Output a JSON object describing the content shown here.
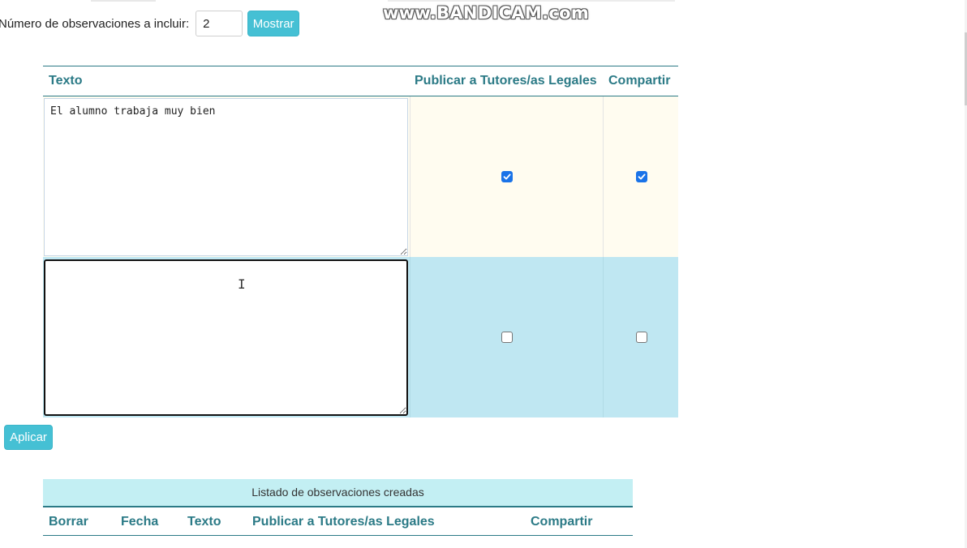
{
  "watermark": "www.BANDICAM.com",
  "count": {
    "label": "Número de observaciones a incluir:",
    "value": "2",
    "show_button": "Mostrar"
  },
  "observations_table": {
    "headers": {
      "text": "Texto",
      "publish": "Publicar a Tutores/as Legales",
      "share": "Compartir"
    },
    "rows": [
      {
        "text": "El alumno trabaja muy bien",
        "publish": true,
        "share": true,
        "color": "#fffcf0"
      },
      {
        "text": "",
        "publish": false,
        "share": false,
        "color": "#bfe7f2"
      }
    ]
  },
  "apply_button": "Aplicar",
  "created_list": {
    "caption": "Listado de observaciones creadas",
    "headers": {
      "delete": "Borrar",
      "date": "Fecha",
      "text": "Texto",
      "publish": "Publicar a Tutores/as Legales",
      "share": "Compartir"
    }
  },
  "colors": {
    "accent": "#45c0d4",
    "header_text": "#2b7a86",
    "checkbox_checked": "#1a73e8"
  }
}
